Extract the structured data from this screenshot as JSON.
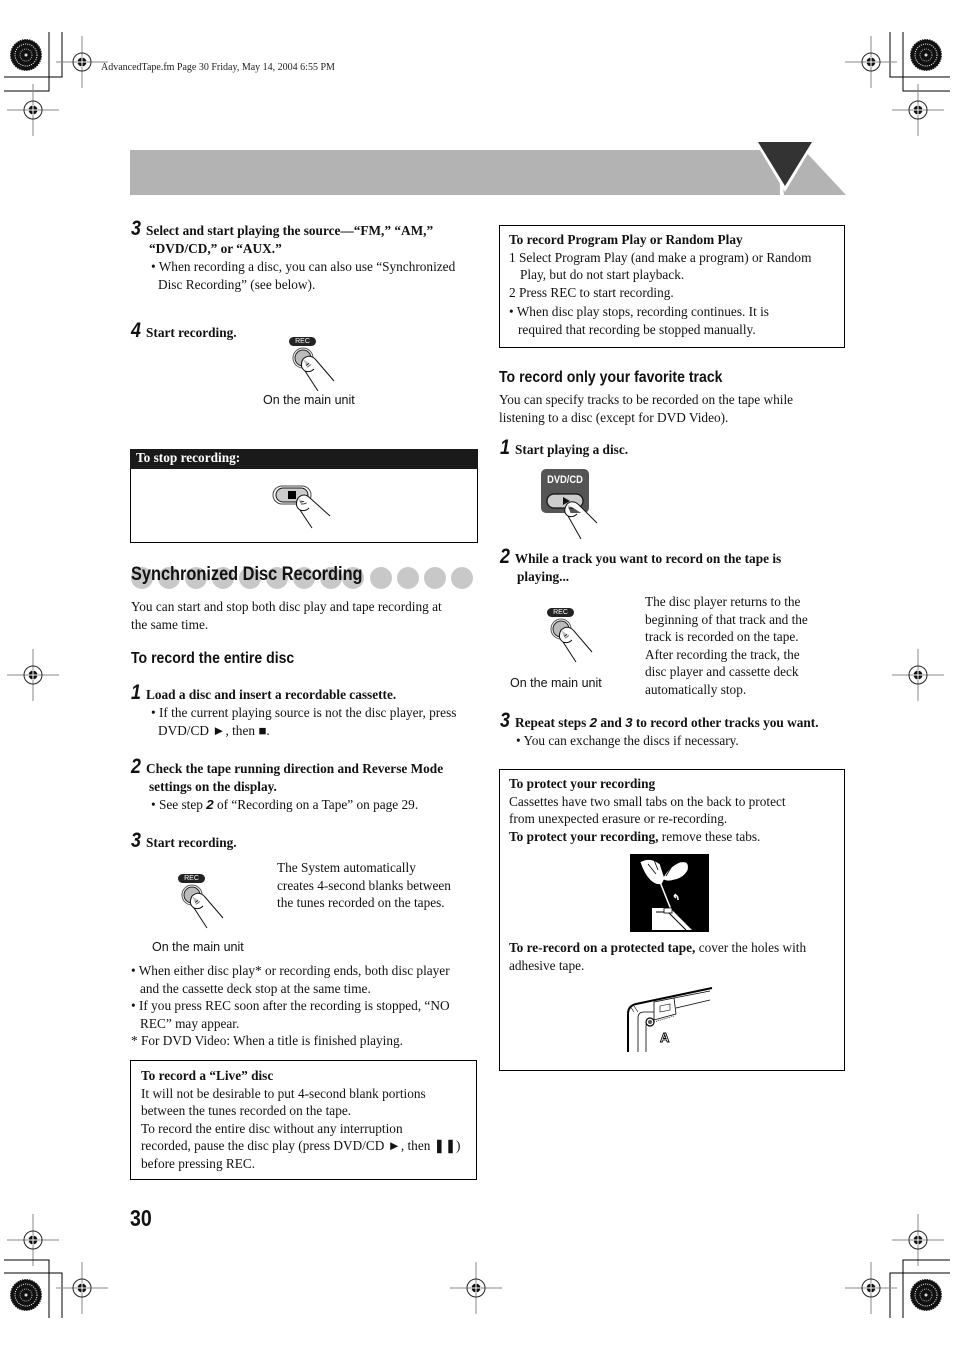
{
  "header": {
    "file_stamp": "AdvancedTape.fm  Page 30  Friday, May 14, 2004  6:55 PM"
  },
  "left": {
    "step3": {
      "num": "3",
      "title_line1": "Select and start playing the source—“FM,” “AM,”",
      "title_line2": "“DVD/CD,” or “AUX.”",
      "bullet_line1": "• When recording a disc, you can also use “Synchronized",
      "bullet_line2": "Disc Recording” (see below)."
    },
    "step4": {
      "num": "4",
      "title": "Start recording.",
      "button_label": "REC",
      "caption": "On the main unit"
    },
    "stop_box": {
      "title": "To stop recording:",
      "button_icon": "stop-icon"
    },
    "sync_section": {
      "title": "Synchronized Disc Recording",
      "intro_line1": "You can start and stop both disc play and tape recording at",
      "intro_line2": "the same time."
    },
    "entire_disc": {
      "heading": "To record the entire disc",
      "step1": {
        "num": "1",
        "title": "Load a disc and insert a recordable cassette.",
        "bullet_line1": "• If the current playing source is not the disc player, press",
        "bullet_line2": "DVD/CD ►, then ■."
      },
      "step2": {
        "num": "2",
        "title_line1": "Check the tape running direction and Reverse Mode",
        "title_line2": "settings on the display.",
        "bullet_pre": "• See step ",
        "bullet_ref": "2",
        "bullet_post": " of “Recording on a Tape” on page 29."
      },
      "step3": {
        "num": "3",
        "title": "Start recording.",
        "button_label": "REC",
        "caption": "On the main unit",
        "side_line1": "The System automatically",
        "side_line2": "creates 4-second blanks between",
        "side_line3": "the tunes recorded on the tapes."
      },
      "notes": [
        "• When either disc play* or recording ends, both disc player",
        "and the cassette deck stop at the same time.",
        "• If you press REC soon after the recording is stopped, “NO",
        "REC” may appear.",
        "*  For DVD Video: When a title is finished playing."
      ]
    },
    "live_box": {
      "title": "To record a “Live” disc",
      "lines": [
        "It will not be desirable to put 4-second blank portions",
        "between the tunes recorded on the tape.",
        "To record the entire disc without any interruption",
        "recorded, pause the disc play (press DVD/CD ►, then ❚❚)",
        "before pressing REC."
      ]
    },
    "page_number": "30"
  },
  "right": {
    "program_box": {
      "title": "To record Program Play or Random Play",
      "lines": [
        "1 Select Program Play (and make a program) or Random",
        "Play, but do not start playback.",
        "2 Press REC to start recording.",
        "• When disc play stops, recording continues. It is",
        "required that recording be stopped manually."
      ]
    },
    "favorite": {
      "heading": "To record only your favorite track",
      "intro_line1": "You can specify tracks to be recorded on the tape while",
      "intro_line2": "listening to a disc (except for DVD Video).",
      "step1": {
        "num": "1",
        "title": "Start playing a disc.",
        "button_label": "DVD/CD"
      },
      "step2": {
        "num": "2",
        "title_line1": "While a track you want to record on the tape is",
        "title_line2": "playing...",
        "button_label": "REC",
        "caption": "On the main unit",
        "side_lines": [
          "The disc player returns to the",
          "beginning of that track and the",
          "track is recorded on the tape.",
          "After recording the track, the",
          "disc player and cassette deck",
          "automatically stop."
        ]
      },
      "step3": {
        "num": "3",
        "title_pre": "Repeat steps ",
        "ref_a": "2",
        "title_mid": " and ",
        "ref_b": "3",
        "title_post": " to record other tracks you want.",
        "bullet": "• You can exchange the discs if necessary."
      }
    },
    "protect_box": {
      "title": "To protect your recording",
      "line1": "Cassettes have two small tabs on the back to protect",
      "line2": "from unexpected erasure or re-recording.",
      "line3_bold": "To protect your recording,",
      "line3_rest": " remove these tabs.",
      "rerecord_bold": "To re-record on a protected tape,",
      "rerecord_rest": " cover the holes with",
      "rerecord_line2": "adhesive tape.",
      "diagram_label": "A"
    }
  }
}
